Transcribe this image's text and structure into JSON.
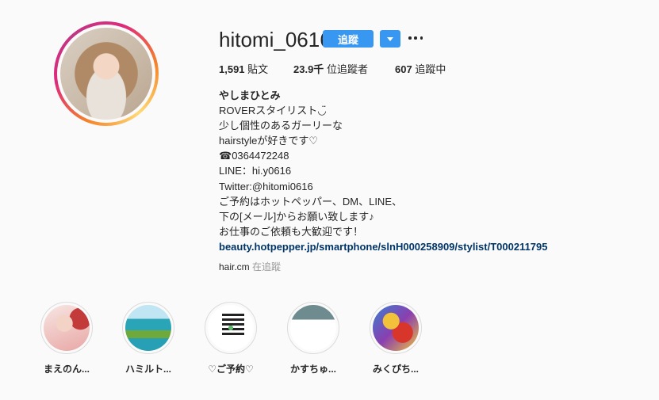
{
  "profile": {
    "username": "hitomi_0616",
    "follow_label": "追蹤",
    "stats": {
      "posts_count": "1,591",
      "posts_label": "貼文",
      "followers_count": "23.9千",
      "followers_label": "位追蹤者",
      "following_count": "607",
      "following_label": "追蹤中"
    },
    "bio": {
      "name": "やしまひとみ",
      "lines": [
        "ROVERスタイリスト◡̈",
        "少し個性のあるガーリーな",
        "hairstyleが好きです♡",
        "☎0364472248",
        "LINE：hi.y0616",
        "Twitter:@hitomi0616",
        "ご予約はホットペッパー、DM、LINE、",
        "下の[メール]からお願い致します♪",
        "お仕事のご依頼も大歓迎です！"
      ],
      "link": "beauty.hotpepper.jp/smartphone/slnH000258909/stylist/T000211795"
    },
    "followed_by": {
      "account": "hair.cm",
      "label": "在追蹤"
    }
  },
  "highlights": [
    {
      "label": "まえのん...",
      "colors": [
        "#f7e6e3",
        "#e8a7a5",
        "#c23a3a"
      ]
    },
    {
      "label": "ハミルト...",
      "colors": [
        "#8fd0e6",
        "#2aa5b8",
        "#6fa83b"
      ]
    },
    {
      "label": "♡ご予約♡",
      "colors": [
        "#ffffff",
        "#222222",
        "#ffffff"
      ]
    },
    {
      "label": "かすちゅ...",
      "colors": [
        "#6e8c8f",
        "#ffffff",
        "#e8f0f2"
      ]
    },
    {
      "label": "みくぴち...",
      "colors": [
        "#f2c23b",
        "#d8362b",
        "#3a7fd0"
      ]
    }
  ],
  "colors": {
    "accent": "#3897f0",
    "link": "#003569",
    "muted": "#999999"
  }
}
